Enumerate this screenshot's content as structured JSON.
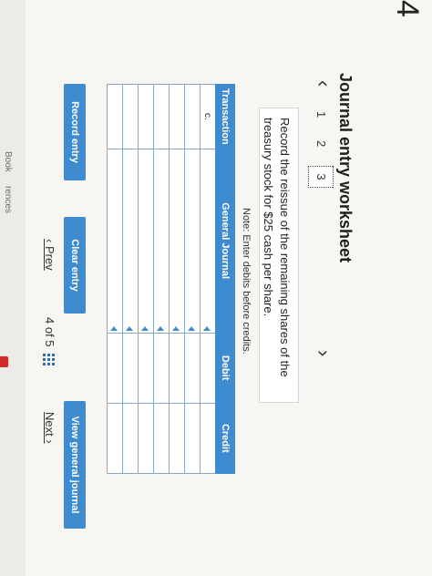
{
  "page_number": "4",
  "sidebar": {
    "items": [
      {
        "label": "Book"
      },
      {
        "label": "rences"
      }
    ]
  },
  "worksheet": {
    "title": "Journal entry worksheet",
    "tabs": [
      {
        "label": "1"
      },
      {
        "label": "2"
      },
      {
        "label": "3"
      }
    ],
    "active_tab": "3",
    "instruction": "Record the reissue of the remaining shares of the treasury stock for $25 cash per share.",
    "note": "Note: Enter debits before credits.",
    "table": {
      "headers": [
        "Transaction",
        "General Journal",
        "Debit",
        "Credit"
      ],
      "rows": [
        [
          "c.",
          "",
          "",
          ""
        ],
        [
          "",
          "",
          "",
          ""
        ],
        [
          "",
          "",
          "",
          ""
        ],
        [
          "",
          "",
          "",
          ""
        ],
        [
          "",
          "",
          "",
          ""
        ],
        [
          "",
          "",
          "",
          ""
        ],
        [
          "",
          "",
          "",
          ""
        ]
      ]
    },
    "buttons": {
      "record": "Record entry",
      "clear": "Clear entry",
      "view": "View general journal"
    }
  },
  "pager": {
    "prev": "Prev",
    "position": "4 of 5",
    "next": "Next"
  }
}
